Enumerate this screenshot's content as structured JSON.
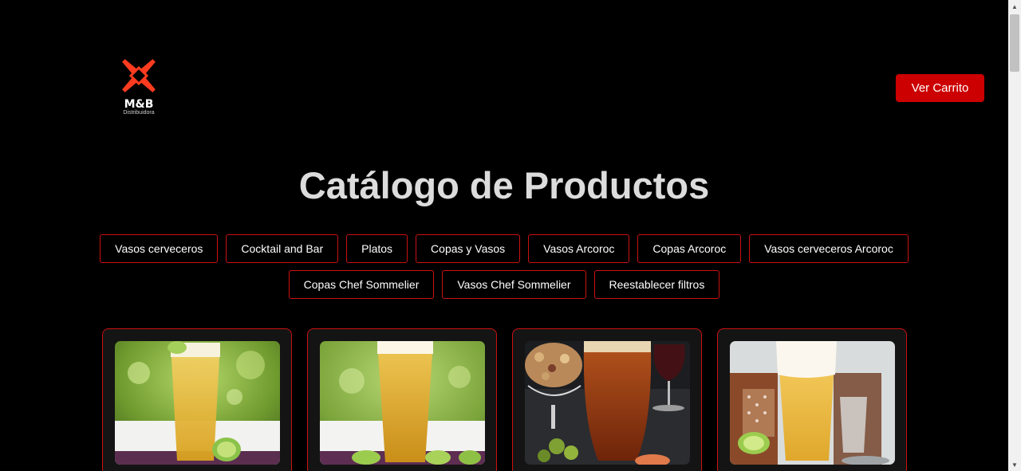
{
  "brand": {
    "name": "M&B",
    "subtitle": "Distribuidora",
    "color": "#ff3b1f"
  },
  "header": {
    "cart_label": "Ver Carrito",
    "cart_color": "#cc0000"
  },
  "page": {
    "title": "Catálogo de Productos"
  },
  "filters": [
    "Vasos cerveceros",
    "Cocktail and Bar",
    "Platos",
    "Copas y Vasos",
    "Vasos Arcoroc",
    "Copas Arcoroc",
    "Vasos cerveceros Arcoroc",
    "Copas Chef Sommelier",
    "Vasos Chef Sommelier",
    "Reestablecer filtros"
  ],
  "accent": "#cc1111",
  "products": [
    {
      "image": "beer-glass-lime-green-background"
    },
    {
      "image": "beer-pint-foam-lime"
    },
    {
      "image": "amber-beer-nuts-olives"
    },
    {
      "image": "beer-glass-foam-rustic"
    }
  ]
}
